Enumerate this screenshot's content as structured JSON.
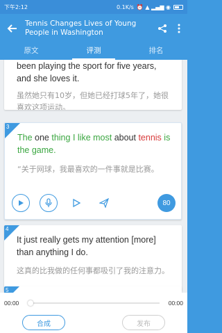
{
  "status_bar": {
    "time": "下午2:12",
    "network_speed": "0.1K/s",
    "signal_icons": "⏰ ▲ ▂▄▆ ◉",
    "battery_level": 0.5
  },
  "app_bar": {
    "title": "Tennis Changes Lives of Young People in Washington"
  },
  "tabs": [
    {
      "label": "原文",
      "active": false
    },
    {
      "label": "评测",
      "active": true
    },
    {
      "label": "排名",
      "active": false
    }
  ],
  "cards": [
    {
      "en": "been playing the sport for five years, and she loves it.",
      "zh": "虽然她只有10岁，但她已经打球5年了，她很喜欢这项运动。"
    },
    {
      "number": "3",
      "en_parts": [
        {
          "text": "The",
          "color": "green"
        },
        {
          "text": " one ",
          "color": "normal"
        },
        {
          "text": "thing",
          "color": "green"
        },
        {
          "text": " ",
          "color": "normal"
        },
        {
          "text": "I like most",
          "color": "green"
        },
        {
          "text": " about ",
          "color": "normal"
        },
        {
          "text": "tennis",
          "color": "red"
        },
        {
          "text": " is the game.",
          "color": "green"
        }
      ],
      "zh": "“关于网球，我最喜欢的一件事就是比赛。",
      "score": "80"
    },
    {
      "number": "4",
      "en": "It just really gets my attention [more] than anything I do.",
      "zh": "这真的比我做的任何事都吸引了我的注意力。"
    },
    {
      "number": "5"
    }
  ],
  "player": {
    "current_time": "00:00",
    "total_time": "00:00",
    "progress": 0
  },
  "buttons": {
    "compose": "合成",
    "publish": "发布"
  },
  "colors": {
    "primary": "#3f9ae0",
    "correct": "#3aa640",
    "wrong": "#d83b3b"
  }
}
